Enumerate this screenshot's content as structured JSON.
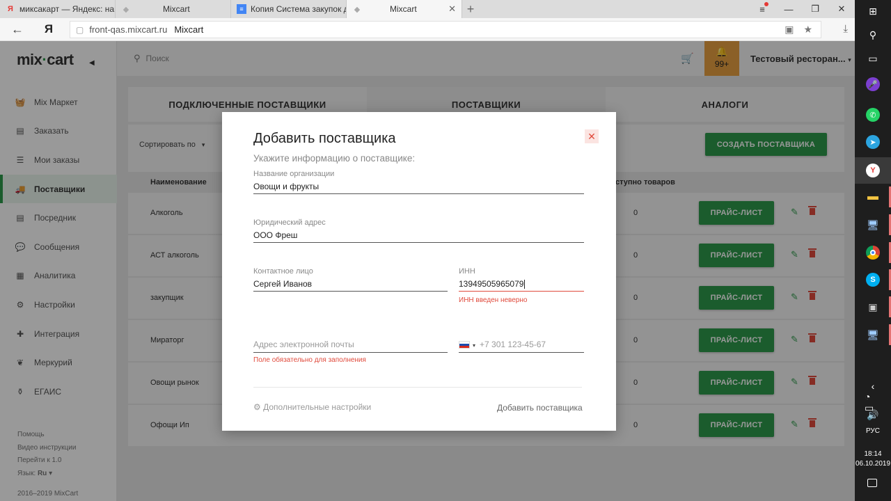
{
  "browser": {
    "tabs": [
      {
        "title": "миксакарт — Яндекс: нашло",
        "icon": "yandex-icon"
      },
      {
        "title": "Mixcart",
        "icon": "mixcart-favicon-icon"
      },
      {
        "title": "Копия Система закупок для",
        "icon": "google-docs-icon"
      },
      {
        "title": "Mixcart",
        "icon": "mixcart-favicon-icon"
      }
    ],
    "url_host": "front-qas.mixcart.ru",
    "url_title": "Mixcart"
  },
  "sidebar": {
    "logo_left": "mix",
    "logo_right": "cart",
    "items": [
      {
        "label": "Mix Маркет",
        "icon": "basket-icon"
      },
      {
        "label": "Заказать",
        "icon": "document-icon"
      },
      {
        "label": "Мои заказы",
        "icon": "list-icon"
      },
      {
        "label": "Поставщики",
        "icon": "truck-icon",
        "active": true
      },
      {
        "label": "Посредник",
        "icon": "document-icon"
      },
      {
        "label": "Сообщения",
        "icon": "chat-icon"
      },
      {
        "label": "Аналитика",
        "icon": "chart-icon"
      },
      {
        "label": "Настройки",
        "icon": "gear-icon"
      },
      {
        "label": "Интеграция",
        "icon": "puzzle-icon"
      },
      {
        "label": "Меркурий",
        "icon": "leaf-icon"
      },
      {
        "label": "ЕГАИС",
        "icon": "bottle-icon"
      }
    ],
    "footer": {
      "help": "Помощь",
      "videos": "Видео инструкции",
      "goto": "Перейти к 1.0",
      "lang_label": "Язык:",
      "lang_value": "Ru"
    },
    "copyright": "2016–2019 MixCart"
  },
  "topbar": {
    "search_placeholder": "Поиск",
    "notifications": "99+",
    "restaurant": "Тестовый ресторан..."
  },
  "content": {
    "tabs": [
      "ПОДКЛЮЧЕННЫЕ ПОСТАВЩИКИ",
      "ПОСТАВЩИКИ",
      "АНАЛОГИ"
    ],
    "sort_label": "Сортировать по",
    "create_button": "СОЗДАТЬ ПОСТАВЩИКА",
    "columns": {
      "name": "Наименование",
      "goods": "ступно товаров"
    },
    "rows": [
      {
        "name": "Алкоголь",
        "count": "0"
      },
      {
        "name": "АСТ алкоголь",
        "count": "0"
      },
      {
        "name": "закупщик",
        "count": "0"
      },
      {
        "name": "Мираторг",
        "count": "0"
      },
      {
        "name": "Овощи рынок",
        "count": "0"
      },
      {
        "name": "Офощи Ип",
        "count": "0"
      }
    ],
    "price_button": "ПРАЙС-ЛИСТ"
  },
  "modal": {
    "title": "Добавить поставщика",
    "subtitle": "Укажите информацию о поставщике:",
    "org_label": "Название организации",
    "org_value": "Овощи и фрукты",
    "address_label": "Юридический адрес",
    "address_value": "ООО Фреш",
    "contact_label": "Контактное лицо",
    "contact_value": "Сергей Иванов",
    "inn_label": "ИНН",
    "inn_value": "13949505965079",
    "inn_error": "ИНН введен неверно",
    "email_placeholder": "Адрес электронной почты",
    "email_error": "Поле обязательно для заполнения",
    "phone_placeholder": "+7 301 123-45-67",
    "advanced": "Дополнительные настройки",
    "submit": "Добавить поставщика"
  },
  "taskbar": {
    "lang": "РУС",
    "time": "18:14",
    "date": "06.10.2019"
  },
  "colors": {
    "accent_green": "#2e9a4b",
    "error_red": "#e04a3c",
    "bell_orange": "#e8a042"
  }
}
